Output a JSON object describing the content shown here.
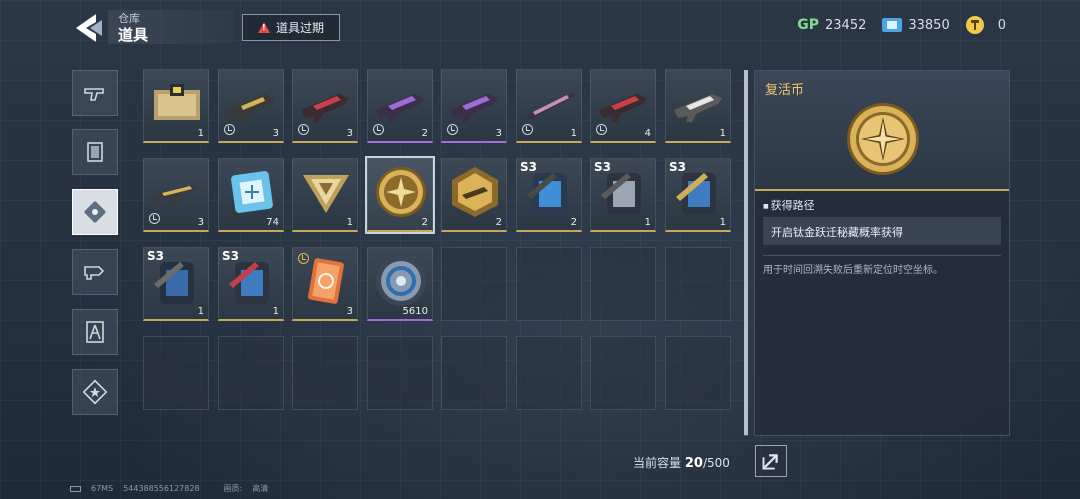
{
  "header": {
    "breadcrumb": "仓库",
    "title": "道具",
    "expired_label": "道具过期"
  },
  "currencies": [
    {
      "icon": "gp-icon",
      "label": "GP",
      "value": "23452"
    },
    {
      "icon": "ticket-icon",
      "value": "33850"
    },
    {
      "icon": "coin-icon",
      "value": "0"
    }
  ],
  "sidebar": {
    "tabs": [
      {
        "icon": "gun-icon"
      },
      {
        "icon": "card-icon"
      },
      {
        "icon": "item-icon",
        "active": true
      },
      {
        "icon": "weapon-part-icon"
      },
      {
        "icon": "character-icon"
      },
      {
        "icon": "star-badge-icon"
      }
    ]
  },
  "inventory": {
    "items": [
      {
        "kind": "crate",
        "qty": "1"
      },
      {
        "kind": "rifle-gold",
        "qty": "3",
        "timed": true
      },
      {
        "kind": "rifle-red",
        "qty": "3",
        "timed": true
      },
      {
        "kind": "rifle-purple",
        "qty": "2",
        "timed": true,
        "rarity": "purple"
      },
      {
        "kind": "rifle-purple",
        "qty": "3",
        "timed": true,
        "rarity": "purple"
      },
      {
        "kind": "rifle-pink",
        "qty": "1",
        "timed": true
      },
      {
        "kind": "rifle-red",
        "qty": "4",
        "timed": true
      },
      {
        "kind": "rifle-white",
        "qty": "1"
      },
      {
        "kind": "smg-gold",
        "qty": "3",
        "timed": true
      },
      {
        "kind": "chip",
        "qty": "74"
      },
      {
        "kind": "triangle-badge",
        "qty": "1"
      },
      {
        "kind": "revive-coin",
        "qty": "2",
        "selected": true
      },
      {
        "kind": "hex-badge",
        "qty": "2"
      },
      {
        "kind": "backpack-blue",
        "qty": "2",
        "tag": "S3"
      },
      {
        "kind": "backpack-silver",
        "qty": "1",
        "tag": "S3"
      },
      {
        "kind": "backpack-gold",
        "qty": "1",
        "tag": "S3"
      },
      {
        "kind": "backpack-dark",
        "qty": "1",
        "tag": "S3"
      },
      {
        "kind": "backpack-red",
        "qty": "1",
        "tag": "S3"
      },
      {
        "kind": "card-orange",
        "qty": "3",
        "timed_gold": true
      },
      {
        "kind": "shield-disc",
        "qty": "5610",
        "rarity": "purple"
      }
    ]
  },
  "capacity": {
    "label": "当前容量",
    "used": "20",
    "total": "/500"
  },
  "detail": {
    "name": "复活币",
    "section_title": "获得路径",
    "source": "开启钛金跃迁秘藏概率获得",
    "description": "用于时间回溯失败后重新定位时空坐标。"
  },
  "footer": {
    "ping": "67MS",
    "id": "544388556127828",
    "quality_label": "画质:",
    "quality_value": "高清"
  },
  "colors": {
    "gold_accent": "#c8a85a",
    "purple_accent": "#a66bd6",
    "name_gold": "#f0c869",
    "warning_red": "#e24b4b"
  }
}
